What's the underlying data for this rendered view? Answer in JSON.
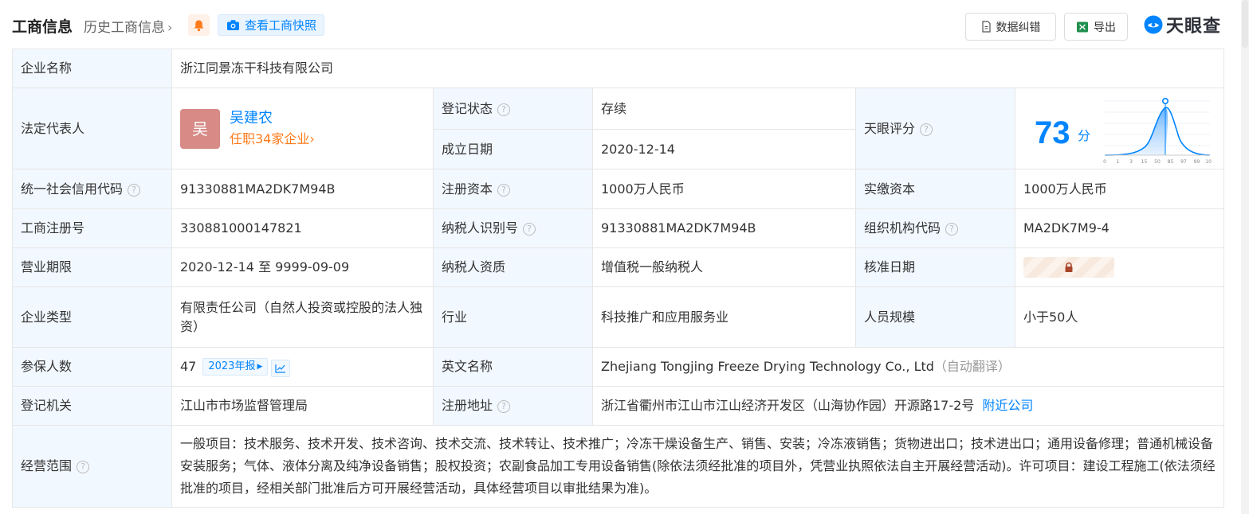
{
  "header": {
    "title": "工商信息",
    "history_label": "历史工商信息",
    "history_chevron": "›",
    "snapshot_label": "查看工商快照",
    "correct_label": "数据纠错",
    "export_label": "导出",
    "logo_text": "天眼查"
  },
  "colors": {
    "accent": "#0084ff",
    "label_bg": "#f2f8ff",
    "status_green": "#14a028",
    "orange": "#ff7a1a"
  },
  "company": {
    "name_label": "企业名称",
    "name_value": "浙江同景冻干科技有限公司",
    "rep_label": "法定代表人",
    "rep_avatar": "吴",
    "rep_name": "吴建农",
    "rep_sub": "任职34家企业",
    "rep_sub_chevron": "›",
    "status_label": "登记状态",
    "status_value": "存续",
    "found_label": "成立日期",
    "found_value": "2020-12-14",
    "score_label": "天眼评分",
    "score_value": "73",
    "score_unit": "分",
    "score_ticks": [
      "0",
      "1",
      "3",
      "15",
      "50",
      "85",
      "97",
      "99",
      "100"
    ],
    "credit_label": "统一社会信用代码",
    "credit_value": "91330881MA2DK7M94B",
    "capital_label": "注册资本",
    "capital_value": "1000万人民币",
    "paid_label": "实缴资本",
    "paid_value": "1000万人民币",
    "regno_label": "工商注册号",
    "regno_value": "330881000147821",
    "taxid_label": "纳税人识别号",
    "taxid_value": "91330881MA2DK7M94B",
    "org_label": "组织机构代码",
    "org_value": "MA2DK7M9-4",
    "term_label": "营业期限",
    "term_value": "2020-12-14 至 9999-09-09",
    "taxq_label": "纳税人资质",
    "taxq_value": "增值税一般纳税人",
    "approve_label": "核准日期",
    "type_label": "企业类型",
    "type_value": "有限责任公司（自然人投资或控股的法人独资）",
    "industry_label": "行业",
    "industry_value": "科技推广和应用服务业",
    "staff_label": "人员规模",
    "staff_value": "小于50人",
    "insured_label": "参保人数",
    "insured_value": "47",
    "insured_year": "2023年报",
    "en_label": "英文名称",
    "en_value": "Zhejiang Tongjing Freeze Drying Technology Co., Ltd",
    "en_auto": "（自动翻译）",
    "authority_label": "登记机关",
    "authority_value": "江山市市场监督管理局",
    "address_label": "注册地址",
    "address_value": "浙江省衢州市江山市江山经济开发区（山海协作园）开源路17-2号",
    "address_link": "附近公司",
    "scope_label": "经营范围",
    "scope_value": "一般项目：技术服务、技术开发、技术咨询、技术交流、技术转让、技术推广；冷冻干燥设备生产、销售、安装；冷冻液销售；货物进出口；技术进出口；通用设备修理；普通机械设备安装服务；气体、液体分离及纯净设备销售；股权投资；农副食品加工专用设备销售(除依法须经批准的项目外，凭营业执照依法自主开展经营活动)。许可项目：建设工程施工(依法须经批准的项目，经相关部门批准后方可开展经营活动，具体经营项目以审批结果为准)。"
  }
}
